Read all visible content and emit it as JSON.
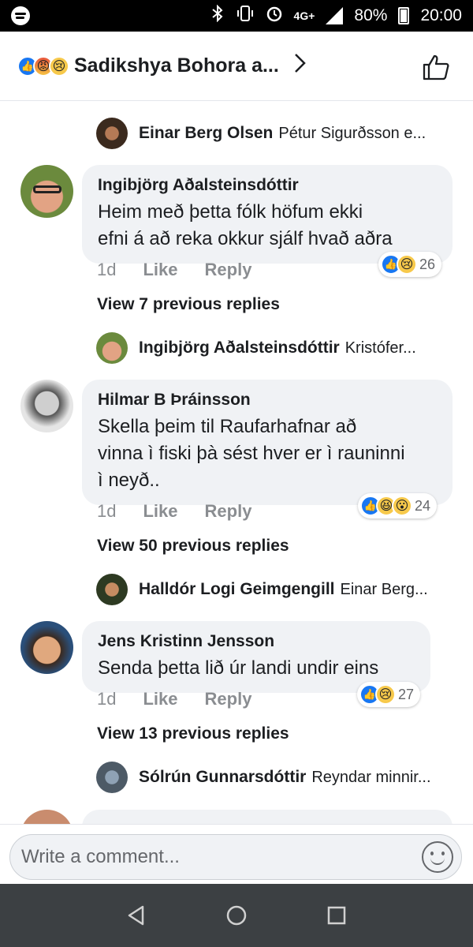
{
  "status": {
    "time": "20:00",
    "battery": "80%",
    "network": "4G+",
    "icons": [
      "spotify-icon",
      "bluetooth-icon",
      "vibrate-icon",
      "alarm-icon",
      "signal-icon",
      "battery-charging-icon"
    ]
  },
  "header": {
    "title": "Sadikshya Bohora a...",
    "reactions": [
      "like",
      "angry",
      "sad"
    ],
    "chevron_icon": "chevron-right-icon",
    "like_icon": "thumbs-up-icon"
  },
  "thread": [
    {
      "type": "reply_preview",
      "name": "Einar Berg Olsen",
      "snippet": "Pétur Sigurðsson e..."
    },
    {
      "type": "comment",
      "author": "Ingibjörg Aðalsteinsdóttir",
      "lines": [
        "Heim með þetta fólk höfum ekki",
        "efni á að reka okkur sjálf hvað aðra"
      ],
      "time": "1d",
      "like": "Like",
      "reply": "Reply",
      "reactions": [
        "like",
        "sad"
      ],
      "count": "26"
    },
    {
      "type": "view_more",
      "text": "View 7 previous replies"
    },
    {
      "type": "reply_preview",
      "name": "Ingibjörg Aðalsteinsdóttir",
      "snippet": "Kristófer..."
    },
    {
      "type": "comment",
      "author": "Hilmar B Þráinsson",
      "lines": [
        "Skella þeim til Raufarhafnar að",
        "vinna ì fiski þà sést hver er ì rauninni",
        "ì neyð.."
      ],
      "time": "1d",
      "like": "Like",
      "reply": "Reply",
      "reactions": [
        "like",
        "haha",
        "wow"
      ],
      "count": "24"
    },
    {
      "type": "view_more",
      "text": "View 50 previous replies"
    },
    {
      "type": "reply_preview",
      "name": "Halldór Logi Geimgengill",
      "snippet": "Einar Berg..."
    },
    {
      "type": "comment",
      "author": "Jens Kristinn Jensson",
      "lines": [
        "Senda þetta lið úr landi undir eins"
      ],
      "time": "1d",
      "like": "Like",
      "reply": "Reply",
      "reactions": [
        "like",
        "sad"
      ],
      "count": "27"
    },
    {
      "type": "view_more",
      "text": "View 13 previous replies"
    },
    {
      "type": "reply_preview",
      "name": "Sólrún Gunnarsdóttir",
      "snippet": "Reyndar minnir..."
    }
  ],
  "composer": {
    "placeholder": "Write a comment..."
  },
  "navbar": {
    "buttons": [
      "back-icon",
      "home-icon",
      "recents-icon"
    ]
  }
}
